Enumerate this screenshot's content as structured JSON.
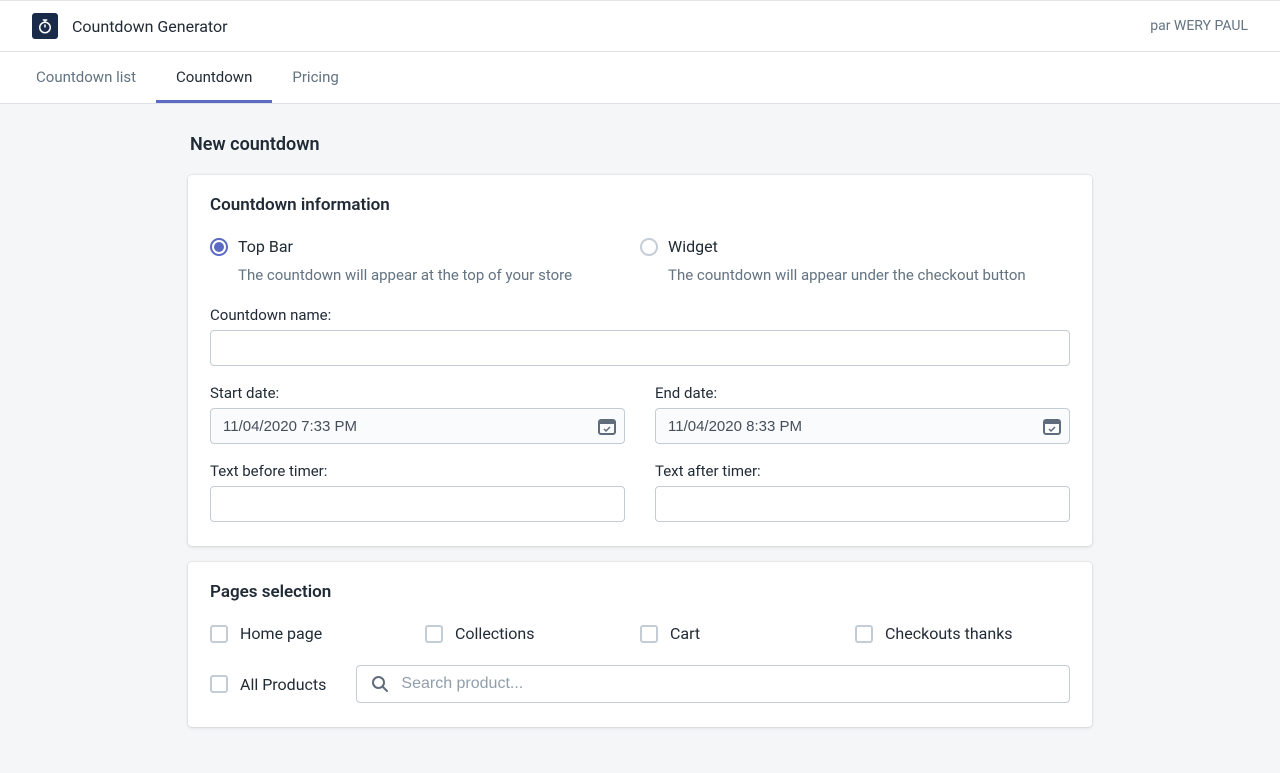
{
  "header": {
    "app_title": "Countdown Generator",
    "byline": "par WERY PAUL"
  },
  "tabs": {
    "list": "Countdown list",
    "countdown": "Countdown",
    "pricing": "Pricing"
  },
  "page_title": "New countdown",
  "info": {
    "title": "Countdown information",
    "topbar_label": "Top Bar",
    "topbar_desc": "The countdown will appear at the top of your store",
    "widget_label": "Widget",
    "widget_desc": "The countdown will appear under the checkout button",
    "name_label": "Countdown name:",
    "name_value": "",
    "start_label": "Start date:",
    "start_value": "11/04/2020 7:33 PM",
    "end_label": "End date:",
    "end_value": "11/04/2020 8:33 PM",
    "before_label": "Text before timer:",
    "before_value": "",
    "after_label": "Text after timer:",
    "after_value": ""
  },
  "pages": {
    "title": "Pages selection",
    "home": "Home page",
    "collections": "Collections",
    "cart": "Cart",
    "checkouts": "Checkouts thanks",
    "all_products": "All Products",
    "search_placeholder": "Search product..."
  }
}
